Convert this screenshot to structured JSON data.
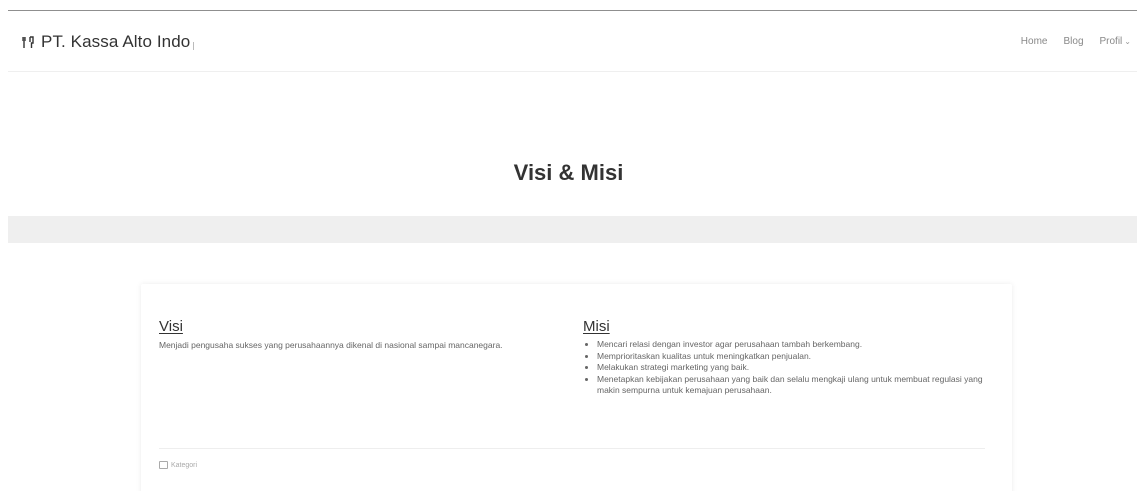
{
  "navbar": {
    "brand": "PT. Kassa Alto Indo",
    "brand_icon": "utensils-icon",
    "links": [
      {
        "label": "Home"
      },
      {
        "label": "Blog"
      },
      {
        "label": "Profil"
      }
    ]
  },
  "hero": {
    "title": "Visi & Misi"
  },
  "visi": {
    "heading": "Visi",
    "text": "Menjadi pengusaha sukses yang perusahaannya dikenal di nasional sampai mancanegara."
  },
  "misi": {
    "heading": "Misi",
    "items": [
      "Mencari relasi dengan investor agar perusahaan tambah berkembang.",
      "Memprioritaskan kualitas untuk meningkatkan penjualan.",
      "Melakukan strategi marketing yang baik.",
      "Menetapkan kebijakan perusahaan yang baik dan selalu mengkaji ulang untuk membuat regulasi yang makin sempurna untuk kemajuan perusahaan."
    ]
  },
  "footer": {
    "category_label": "Kategori",
    "category_icon": "folder-icon"
  }
}
